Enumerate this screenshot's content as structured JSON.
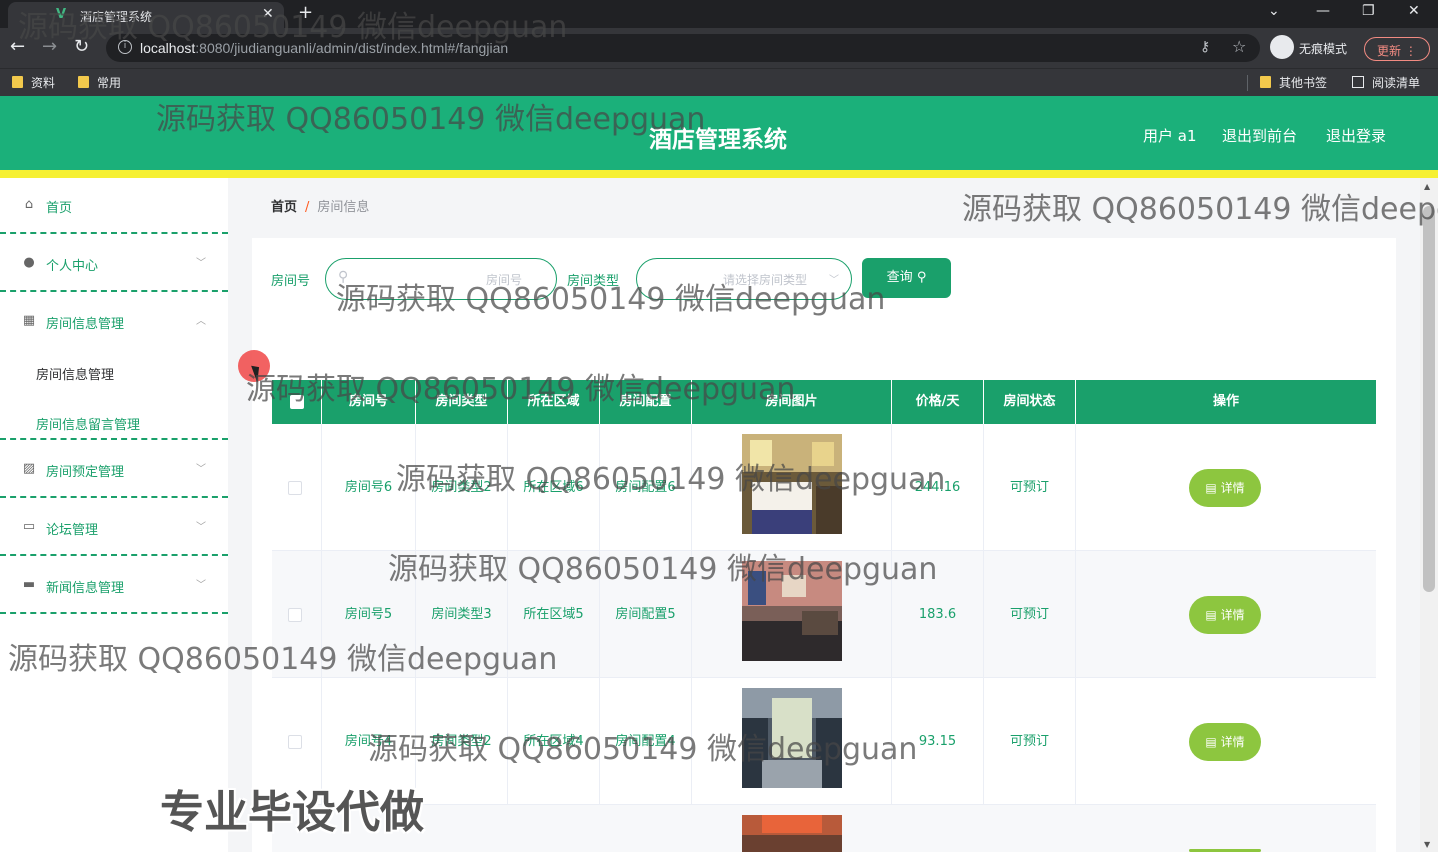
{
  "browser": {
    "tab_title": "酒店管理系统",
    "tab_favicon": "V",
    "url_host": "localhost",
    "url_rest": ":8080/jiudianguanli/admin/dist/index.html#/fangjian",
    "incognito_label": "无痕模式",
    "update_label": "更新",
    "bookmarks": [
      "资料",
      "常用"
    ],
    "other_bookmarks": "其他书签",
    "reading_list": "阅读清单"
  },
  "header": {
    "title": "酒店管理系统",
    "user": "用户 a1",
    "back_to_front": "退出到前台",
    "logout": "退出登录"
  },
  "sidebar": {
    "home": "首页",
    "personal": "个人中心",
    "room_mgmt": "房间信息管理",
    "room_sub1": "房间信息管理",
    "room_sub2": "房间信息留言管理",
    "booking": "房间预定管理",
    "forum": "论坛管理",
    "news": "新闻信息管理"
  },
  "breadcrumb": {
    "home": "首页",
    "sep": "/",
    "current": "房间信息"
  },
  "search": {
    "room_no_label": "房间号",
    "room_no_placeholder": "房间号",
    "room_type_label": "房间类型",
    "room_type_placeholder": "请选择房间类型",
    "query_button": "查询"
  },
  "table": {
    "headers": [
      "房间号",
      "房间类型",
      "所在区域",
      "房间配置",
      "房间图片",
      "价格/天",
      "房间状态",
      "操作"
    ],
    "rows": [
      {
        "room_no": "房间号6",
        "type": "房间类型2",
        "area": "所在区域6",
        "config": "房间配置6",
        "price": "244.16",
        "status": "可预订",
        "action": "详情"
      },
      {
        "room_no": "房间号5",
        "type": "房间类型3",
        "area": "所在区域5",
        "config": "房间配置5",
        "price": "183.6",
        "status": "可预订",
        "action": "详情"
      },
      {
        "room_no": "房间号4",
        "type": "房间类型2",
        "area": "所在区域4",
        "config": "房间配置4",
        "price": "93.15",
        "status": "可预订",
        "action": "详情"
      }
    ]
  },
  "overlay": {
    "watermark": "源码获取 QQ86050149 微信deepguan",
    "promo": "专业毕设代做"
  },
  "colors": {
    "primary": "#1bb07a",
    "stripe": "#f6f033",
    "detail_button": "#8dc63f"
  }
}
